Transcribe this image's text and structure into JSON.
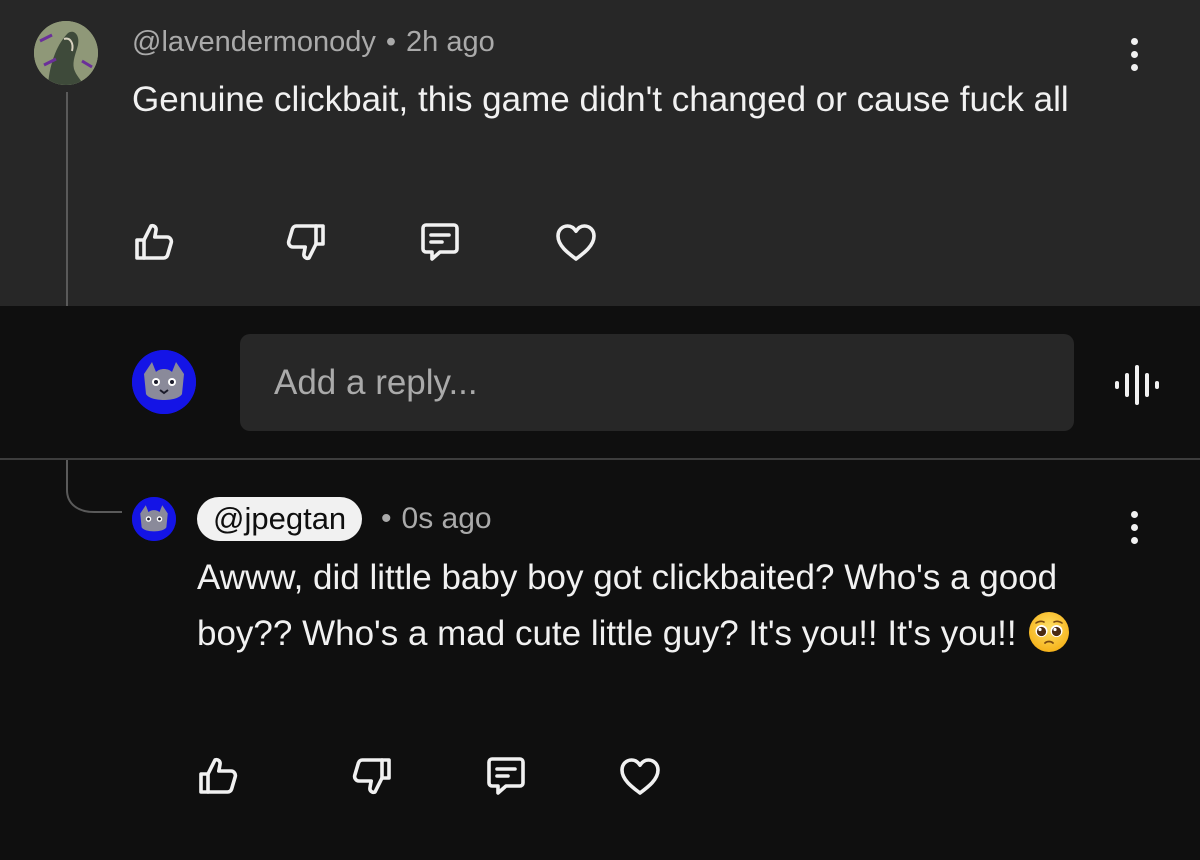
{
  "top_comment": {
    "handle": "@lavendermonody",
    "separator": "•",
    "time": "2h ago",
    "text": "Genuine clickbait, this game didn't changed or cause fuck all"
  },
  "reply_box": {
    "placeholder": "Add a reply..."
  },
  "reply": {
    "handle": "@jpegtan",
    "separator": "•",
    "time": "0s ago",
    "text": "Awww, did little baby boy got clickbaited? Who's a good boy?? Who's a mad cute little guy? It's you!! It's you!!",
    "emoji": "pleading-face"
  },
  "icons": [
    "like-icon",
    "dislike-icon",
    "reply-icon",
    "heart-icon",
    "more-icon",
    "voice-search-icon"
  ],
  "colors": {
    "top_bg": "#272727",
    "page_bg": "#0f0f0f",
    "text": "#f1f1f1",
    "muted": "#aaaaaa",
    "avatar_blue": "#1414e6"
  }
}
